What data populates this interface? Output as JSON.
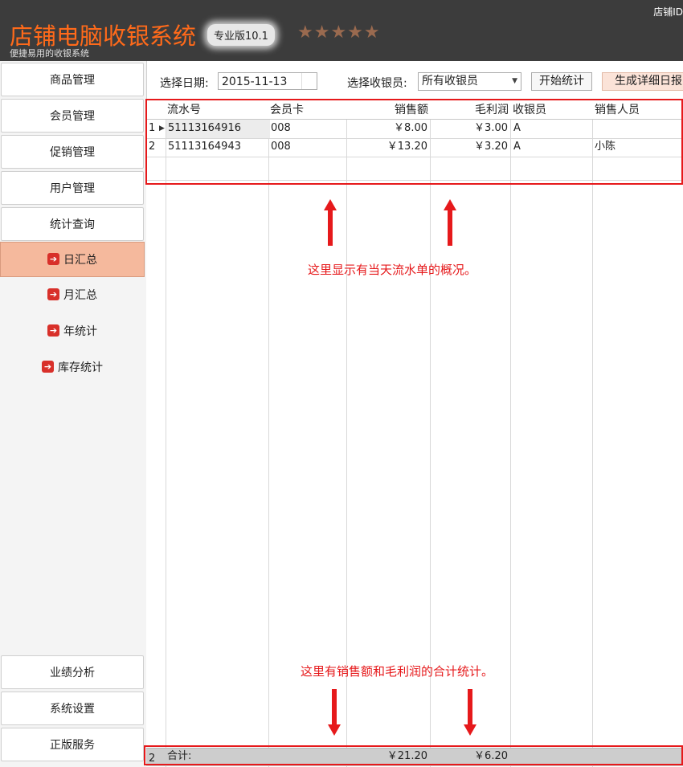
{
  "header": {
    "title": "店铺电脑收银系统",
    "subtitle": "便捷易用的收银系统",
    "edition": "专业版10.1",
    "stars": "★★★★★",
    "shop_id_label": "店铺ID"
  },
  "sidebar": {
    "items": [
      {
        "label": "商品管理"
      },
      {
        "label": "会员管理"
      },
      {
        "label": "促销管理"
      },
      {
        "label": "用户管理"
      },
      {
        "label": "统计查询"
      }
    ],
    "sub_items": [
      {
        "label": "日汇总",
        "active": true
      },
      {
        "label": "月汇总"
      },
      {
        "label": "年统计"
      },
      {
        "label": "库存统计"
      }
    ],
    "bottom_items": [
      {
        "label": "业绩分析"
      },
      {
        "label": "系统设置"
      },
      {
        "label": "正版服务"
      }
    ]
  },
  "toolbar": {
    "date_label": "选择日期:",
    "date_value": "2015-11-13",
    "cashier_label": "选择收银员:",
    "cashier_value": "所有收银员",
    "start_button": "开始统计",
    "report_button": "生成详细日报"
  },
  "table": {
    "columns": [
      "流水号",
      "会员卡",
      "销售额",
      "毛利润",
      "收银员",
      "销售人员"
    ],
    "rows": [
      {
        "num": "1",
        "serial": "51113164916",
        "card": "008",
        "sales": "￥8.00",
        "profit": "￥3.00",
        "cashier": "A",
        "seller": ""
      },
      {
        "num": "2",
        "serial": "51113164943",
        "card": "008",
        "sales": "￥13.20",
        "profit": "￥3.20",
        "cashier": "A",
        "seller": "小陈"
      }
    ],
    "total": {
      "count": "2",
      "label": "合计:",
      "sales": "￥21.20",
      "profit": "￥6.20"
    }
  },
  "annotations": {
    "top_note": "这里显示有当天流水单的概况。",
    "bottom_note": "这里有销售额和毛利润的合计统计。",
    "color": "#e6191b"
  },
  "colors": {
    "brand": "#ff6a1a",
    "header_bg": "#3c3c3c",
    "active_nav": "#f5b99d"
  }
}
